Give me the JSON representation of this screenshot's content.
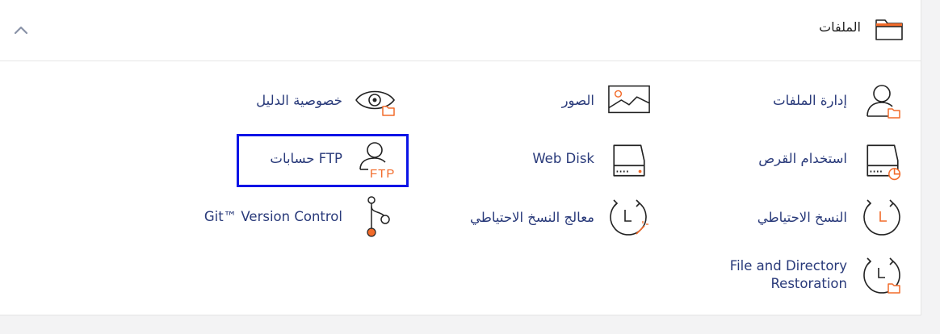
{
  "section": {
    "title": "الملفات",
    "icon": "folder-icon",
    "toggle_icon": "chevron-up-icon"
  },
  "tools": [
    {
      "key": "file-manager",
      "label": "إدارة الملفات",
      "icon": "user-folder-icon"
    },
    {
      "key": "images",
      "label": "الصور",
      "icon": "image-icon"
    },
    {
      "key": "directory-privacy",
      "label": "خصوصية الدليل",
      "icon": "eye-folder-icon"
    },
    {
      "key": "disk-usage",
      "label": "استخدام القرص",
      "icon": "disk-pie-icon"
    },
    {
      "key": "web-disk",
      "label": "Web Disk",
      "icon": "disk-icon"
    },
    {
      "key": "ftp-accounts",
      "label": "حسابات FTP",
      "icon": "user-ftp-icon",
      "icon_text": "FTP"
    },
    {
      "key": "backup",
      "label": "النسخ الاحتياطي",
      "icon": "clock-backup-icon"
    },
    {
      "key": "backup-wizard",
      "label": "معالج النسخ الاحتياطي",
      "icon": "clock-wand-icon"
    },
    {
      "key": "git",
      "label": "Git™ Version Control",
      "icon": "git-branch-icon"
    },
    {
      "key": "file-restore",
      "label": "File and Directory Restoration",
      "label_lines": [
        "File and Directory",
        "Restoration"
      ],
      "icon": "clock-folder-icon"
    }
  ],
  "colors": {
    "accent": "#f26b2a",
    "link": "#293a7a",
    "highlight": "#0b14e6"
  }
}
